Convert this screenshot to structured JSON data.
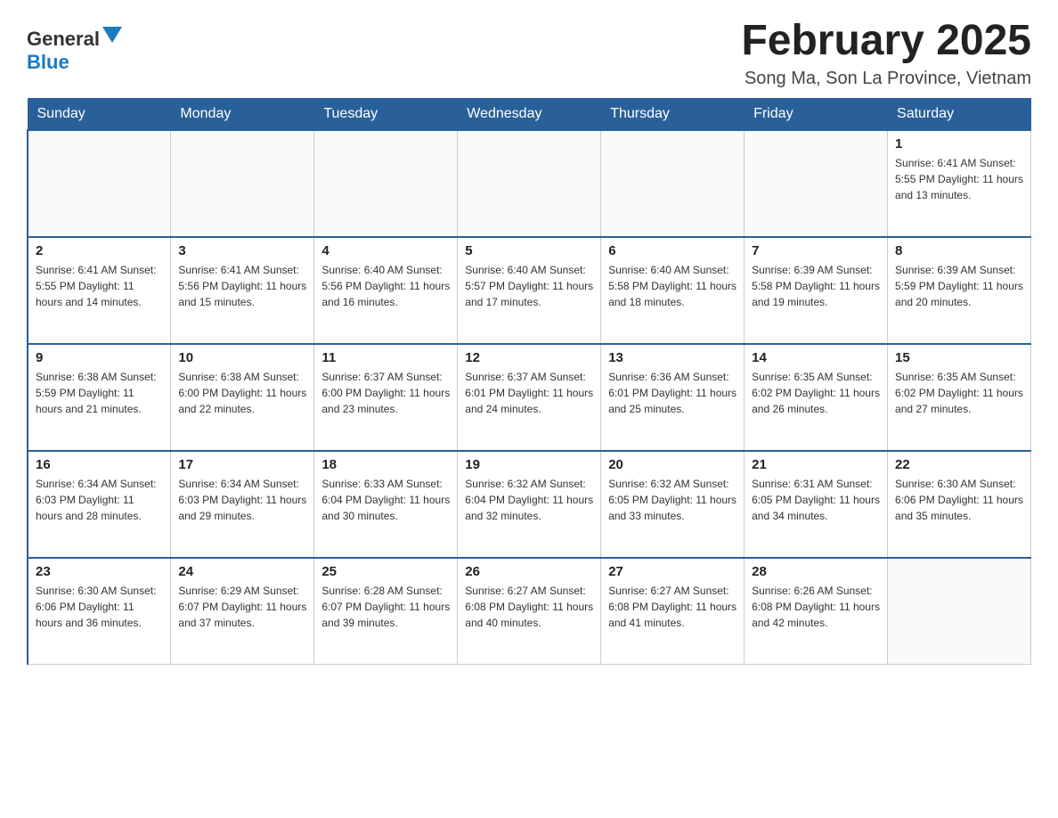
{
  "header": {
    "logo_general": "General",
    "logo_blue": "Blue",
    "month_title": "February 2025",
    "location": "Song Ma, Son La Province, Vietnam"
  },
  "days_of_week": [
    "Sunday",
    "Monday",
    "Tuesday",
    "Wednesday",
    "Thursday",
    "Friday",
    "Saturday"
  ],
  "weeks": [
    [
      {
        "day": "",
        "info": ""
      },
      {
        "day": "",
        "info": ""
      },
      {
        "day": "",
        "info": ""
      },
      {
        "day": "",
        "info": ""
      },
      {
        "day": "",
        "info": ""
      },
      {
        "day": "",
        "info": ""
      },
      {
        "day": "1",
        "info": "Sunrise: 6:41 AM\nSunset: 5:55 PM\nDaylight: 11 hours and 13 minutes."
      }
    ],
    [
      {
        "day": "2",
        "info": "Sunrise: 6:41 AM\nSunset: 5:55 PM\nDaylight: 11 hours and 14 minutes."
      },
      {
        "day": "3",
        "info": "Sunrise: 6:41 AM\nSunset: 5:56 PM\nDaylight: 11 hours and 15 minutes."
      },
      {
        "day": "4",
        "info": "Sunrise: 6:40 AM\nSunset: 5:56 PM\nDaylight: 11 hours and 16 minutes."
      },
      {
        "day": "5",
        "info": "Sunrise: 6:40 AM\nSunset: 5:57 PM\nDaylight: 11 hours and 17 minutes."
      },
      {
        "day": "6",
        "info": "Sunrise: 6:40 AM\nSunset: 5:58 PM\nDaylight: 11 hours and 18 minutes."
      },
      {
        "day": "7",
        "info": "Sunrise: 6:39 AM\nSunset: 5:58 PM\nDaylight: 11 hours and 19 minutes."
      },
      {
        "day": "8",
        "info": "Sunrise: 6:39 AM\nSunset: 5:59 PM\nDaylight: 11 hours and 20 minutes."
      }
    ],
    [
      {
        "day": "9",
        "info": "Sunrise: 6:38 AM\nSunset: 5:59 PM\nDaylight: 11 hours and 21 minutes."
      },
      {
        "day": "10",
        "info": "Sunrise: 6:38 AM\nSunset: 6:00 PM\nDaylight: 11 hours and 22 minutes."
      },
      {
        "day": "11",
        "info": "Sunrise: 6:37 AM\nSunset: 6:00 PM\nDaylight: 11 hours and 23 minutes."
      },
      {
        "day": "12",
        "info": "Sunrise: 6:37 AM\nSunset: 6:01 PM\nDaylight: 11 hours and 24 minutes."
      },
      {
        "day": "13",
        "info": "Sunrise: 6:36 AM\nSunset: 6:01 PM\nDaylight: 11 hours and 25 minutes."
      },
      {
        "day": "14",
        "info": "Sunrise: 6:35 AM\nSunset: 6:02 PM\nDaylight: 11 hours and 26 minutes."
      },
      {
        "day": "15",
        "info": "Sunrise: 6:35 AM\nSunset: 6:02 PM\nDaylight: 11 hours and 27 minutes."
      }
    ],
    [
      {
        "day": "16",
        "info": "Sunrise: 6:34 AM\nSunset: 6:03 PM\nDaylight: 11 hours and 28 minutes."
      },
      {
        "day": "17",
        "info": "Sunrise: 6:34 AM\nSunset: 6:03 PM\nDaylight: 11 hours and 29 minutes."
      },
      {
        "day": "18",
        "info": "Sunrise: 6:33 AM\nSunset: 6:04 PM\nDaylight: 11 hours and 30 minutes."
      },
      {
        "day": "19",
        "info": "Sunrise: 6:32 AM\nSunset: 6:04 PM\nDaylight: 11 hours and 32 minutes."
      },
      {
        "day": "20",
        "info": "Sunrise: 6:32 AM\nSunset: 6:05 PM\nDaylight: 11 hours and 33 minutes."
      },
      {
        "day": "21",
        "info": "Sunrise: 6:31 AM\nSunset: 6:05 PM\nDaylight: 11 hours and 34 minutes."
      },
      {
        "day": "22",
        "info": "Sunrise: 6:30 AM\nSunset: 6:06 PM\nDaylight: 11 hours and 35 minutes."
      }
    ],
    [
      {
        "day": "23",
        "info": "Sunrise: 6:30 AM\nSunset: 6:06 PM\nDaylight: 11 hours and 36 minutes."
      },
      {
        "day": "24",
        "info": "Sunrise: 6:29 AM\nSunset: 6:07 PM\nDaylight: 11 hours and 37 minutes."
      },
      {
        "day": "25",
        "info": "Sunrise: 6:28 AM\nSunset: 6:07 PM\nDaylight: 11 hours and 39 minutes."
      },
      {
        "day": "26",
        "info": "Sunrise: 6:27 AM\nSunset: 6:08 PM\nDaylight: 11 hours and 40 minutes."
      },
      {
        "day": "27",
        "info": "Sunrise: 6:27 AM\nSunset: 6:08 PM\nDaylight: 11 hours and 41 minutes."
      },
      {
        "day": "28",
        "info": "Sunrise: 6:26 AM\nSunset: 6:08 PM\nDaylight: 11 hours and 42 minutes."
      },
      {
        "day": "",
        "info": ""
      }
    ]
  ]
}
